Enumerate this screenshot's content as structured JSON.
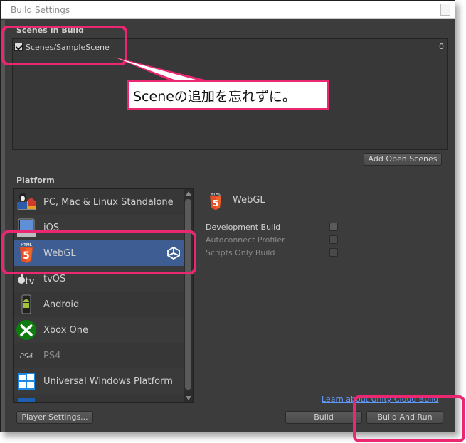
{
  "window": {
    "title": "Build Settings"
  },
  "scenes": {
    "header": "Scenes In Build",
    "items": [
      {
        "name": "Scenes/SampleScene",
        "checked": true,
        "index": "0"
      }
    ],
    "add_open_scenes": "Add Open Scenes"
  },
  "annotation": {
    "callout": "Sceneの追加を忘れずに。",
    "color": "#ec2772"
  },
  "platform": {
    "header": "Platform",
    "items": [
      {
        "label": "PC, Mac & Linux Standalone",
        "icon": "pc-mac-linux-icon"
      },
      {
        "label": "iOS",
        "icon": "ios-device-icon"
      },
      {
        "label": "WebGL",
        "icon": "html5-icon",
        "selected": true
      },
      {
        "label": "tvOS",
        "icon": "apple-tv-icon"
      },
      {
        "label": "Android",
        "icon": "android-icon"
      },
      {
        "label": "Xbox One",
        "icon": "xbox-icon"
      },
      {
        "label": "PS4",
        "icon": "ps4-icon",
        "disabled": true
      },
      {
        "label": "Universal Windows Platform",
        "icon": "windows-icon"
      }
    ]
  },
  "selected_platform": {
    "title": "WebGL",
    "options": [
      {
        "label": "Development Build",
        "enabled": true,
        "checked": false
      },
      {
        "label": "Autoconnect Profiler",
        "enabled": false,
        "checked": false
      },
      {
        "label": "Scripts Only Build",
        "enabled": false,
        "checked": false
      }
    ]
  },
  "footer": {
    "cloud_link": "Learn about Unity Cloud Build",
    "player_settings": "Player Settings...",
    "build": "Build",
    "build_and_run": "Build And Run"
  },
  "colors": {
    "accent": "#ec2772",
    "selection": "#3e5d92",
    "link": "#5f9bff"
  }
}
